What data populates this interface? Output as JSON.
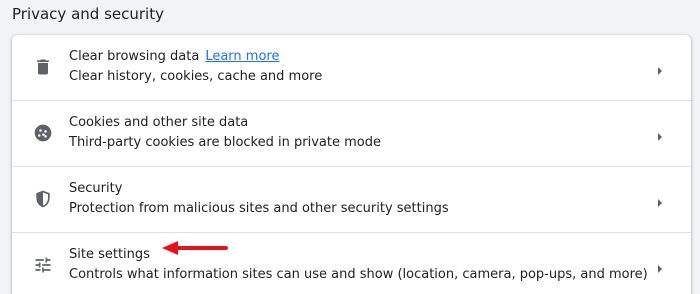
{
  "section": {
    "title": "Privacy and security"
  },
  "rows": [
    {
      "title": "Clear browsing data",
      "link": "Learn more",
      "subtitle": "Clear history, cookies, cache and more",
      "icon": "trash-icon"
    },
    {
      "title": "Cookies and other site data",
      "subtitle": "Third-party cookies are blocked in private mode",
      "icon": "cookie-icon"
    },
    {
      "title": "Security",
      "subtitle": "Protection from malicious sites and other security settings",
      "icon": "shield-icon"
    },
    {
      "title": "Site settings",
      "subtitle": "Controls what information sites can use and show (location, camera, pop-ups, and more)",
      "icon": "tune-icon"
    }
  ],
  "colors": {
    "background": "#f1f3f4",
    "card": "#ffffff",
    "link": "#1a73e8",
    "annotation_arrow": "#e8141c",
    "icon": "#5f6368"
  },
  "annotation": {
    "icon": "red-arrow-icon",
    "points_to": "Site settings"
  }
}
